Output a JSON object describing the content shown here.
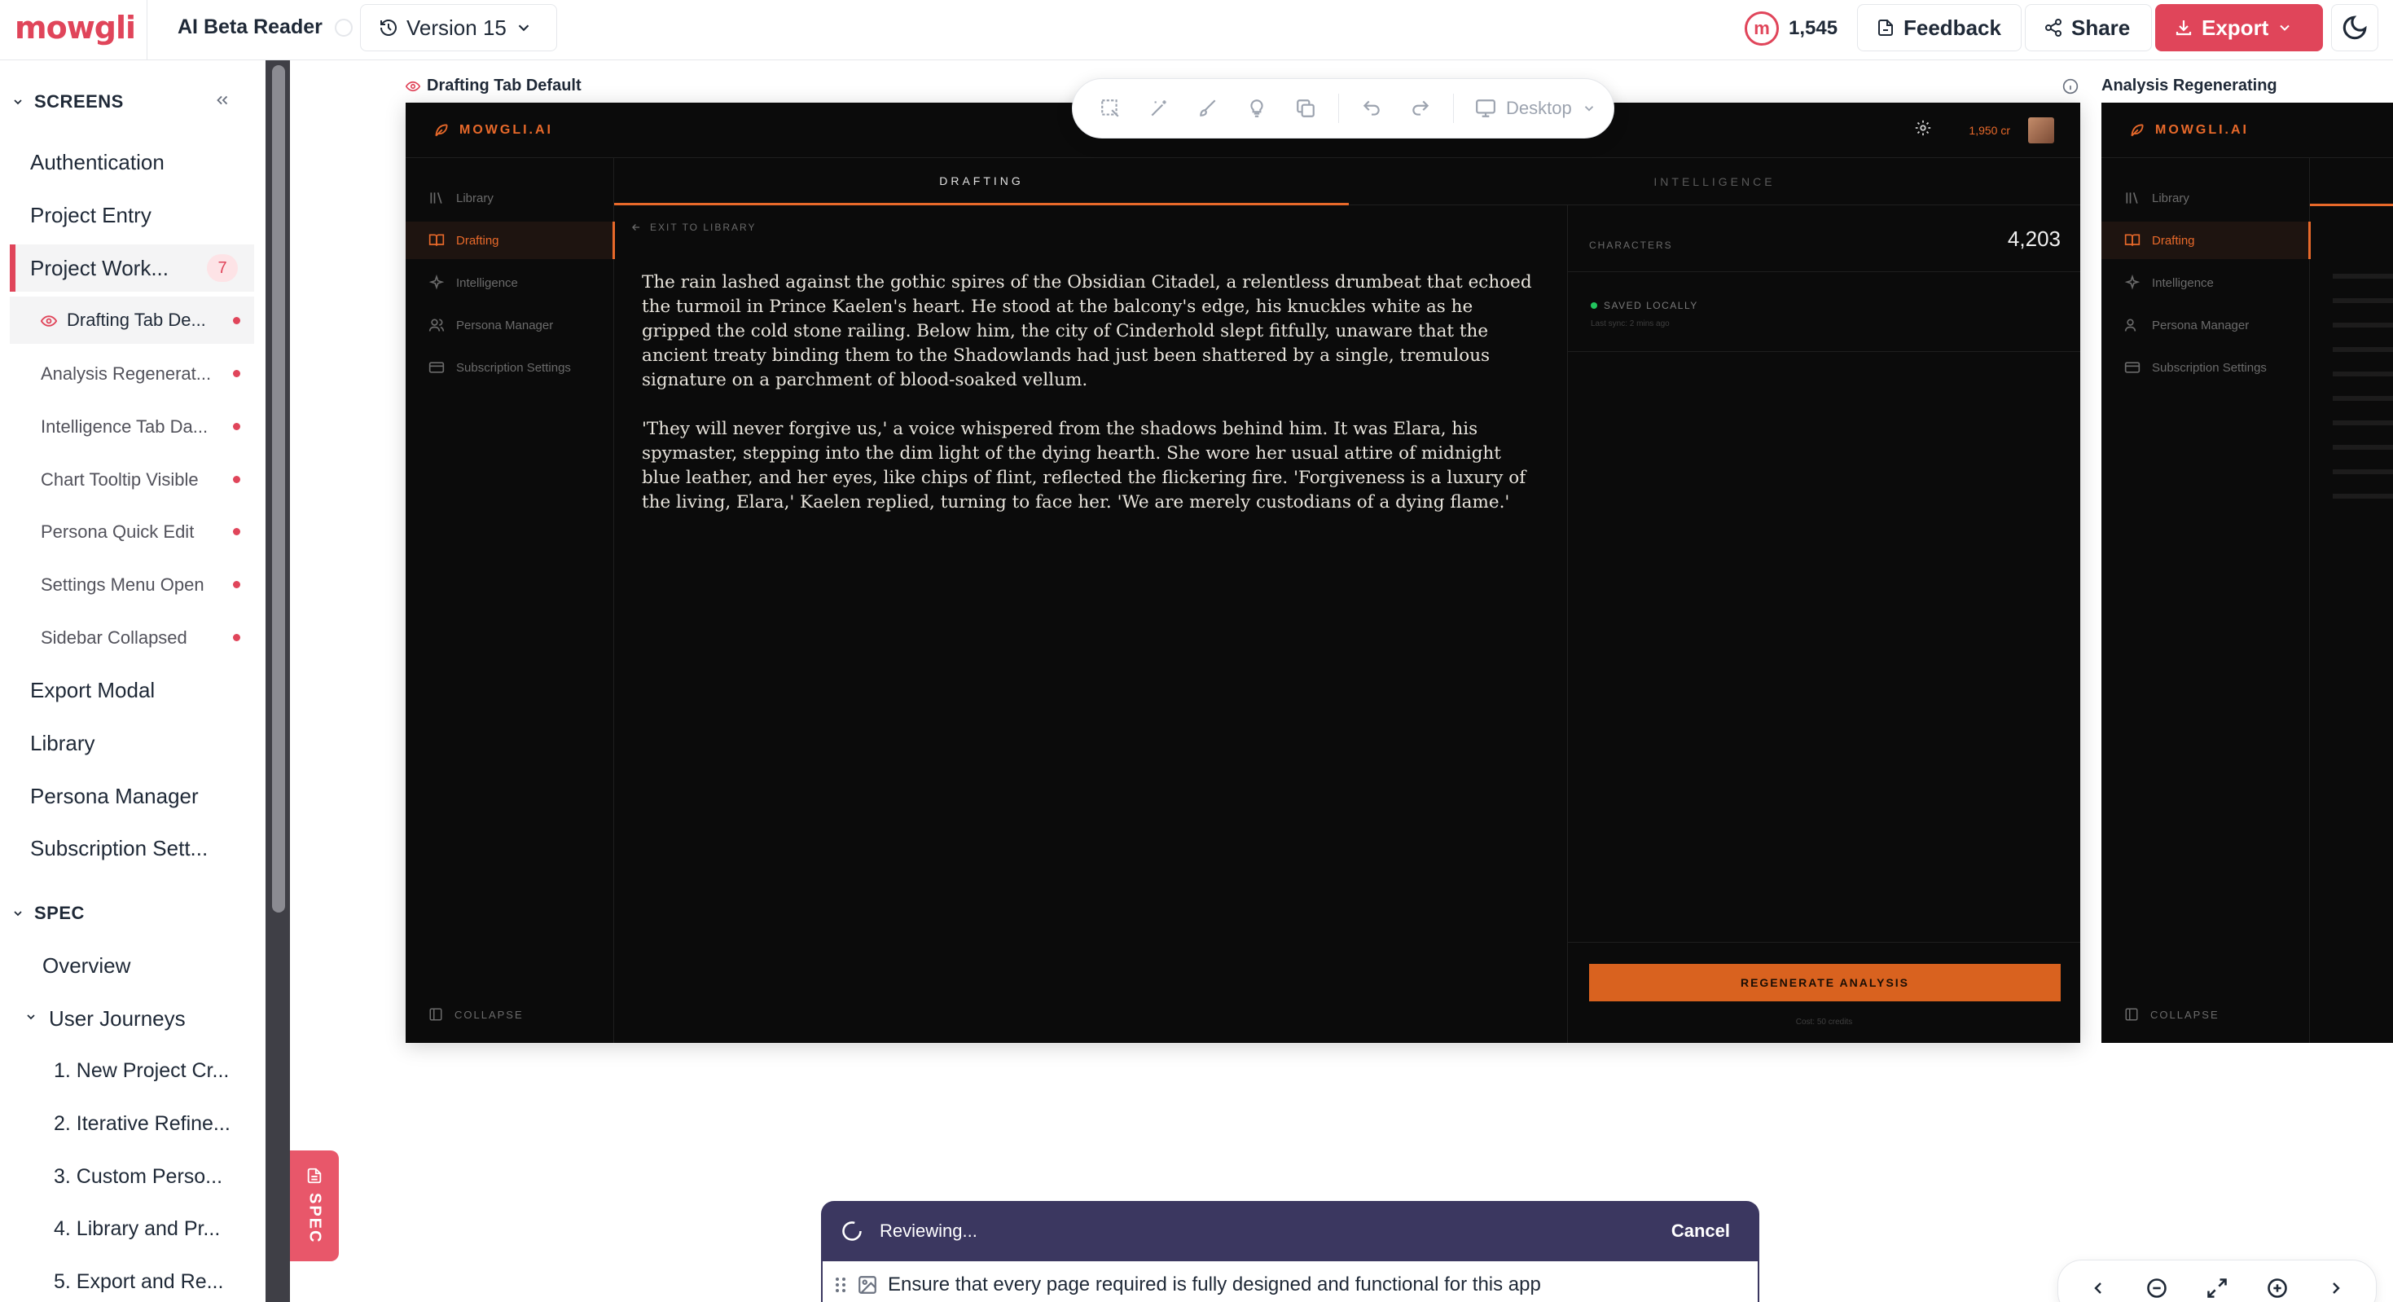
{
  "topbar": {
    "logo": "mowgli",
    "app_title": "AI Beta Reader",
    "version_label": "Version 15",
    "credits": "1,545",
    "credits_badge": "m",
    "feedback_label": "Feedback",
    "share_label": "Share",
    "export_label": "Export"
  },
  "sidebar": {
    "screens_heading": "SCREENS",
    "spec_heading": "SPEC",
    "screens": [
      {
        "label": "Authentication"
      },
      {
        "label": "Project Entry"
      },
      {
        "label": "Project Work...",
        "badge": "7"
      },
      {
        "label": "Export Modal"
      },
      {
        "label": "Library"
      },
      {
        "label": "Persona Manager"
      },
      {
        "label": "Subscription Sett..."
      }
    ],
    "project_children": [
      {
        "label": "Drafting Tab De..."
      },
      {
        "label": "Analysis Regenerat..."
      },
      {
        "label": "Intelligence Tab Da..."
      },
      {
        "label": "Chart Tooltip Visible"
      },
      {
        "label": "Persona Quick Edit"
      },
      {
        "label": "Settings Menu Open"
      },
      {
        "label": "Sidebar Collapsed"
      }
    ],
    "spec_items": [
      {
        "label": "Overview"
      },
      {
        "label": "User Journeys"
      }
    ],
    "journeys": [
      {
        "label": "1. New Project Cr..."
      },
      {
        "label": "2. Iterative Refine..."
      },
      {
        "label": "3. Custom Perso..."
      },
      {
        "label": "4. Library and Pr..."
      },
      {
        "label": "5. Export and Re..."
      }
    ]
  },
  "canvas": {
    "frame1_label": "Drafting Tab Default",
    "frame2_label": "Analysis Regenerating",
    "spec_tab_label": "SPEC"
  },
  "toolbar": {
    "device": "Desktop"
  },
  "mockup": {
    "brand": "MOWGLI.AI",
    "credits": "1,950 cr",
    "nav": [
      {
        "label": "Library",
        "icon": "library-icon"
      },
      {
        "label": "Drafting",
        "icon": "book-icon"
      },
      {
        "label": "Intelligence",
        "icon": "sparkle-icon"
      },
      {
        "label": "Persona Manager",
        "icon": "users-icon"
      },
      {
        "label": "Subscription Settings",
        "icon": "card-icon"
      }
    ],
    "collapse_label": "COLLAPSE",
    "tabs": [
      "DRAFTING",
      "INTELLIGENCE"
    ],
    "exit_label": "EXIT TO LIBRARY",
    "paragraphs": [
      "The rain lashed against the gothic spires of the Obsidian Citadel, a relentless drumbeat that echoed the turmoil in Prince Kaelen's heart. He stood at the balcony's edge, his knuckles white as he gripped the cold stone railing. Below him, the city of Cinderhold slept fitfully, unaware that the ancient treaty binding them to the Shadowlands had just been shattered by a single, tremulous signature on a parchment of blood-soaked vellum.",
      "'They will never forgive us,' a voice whispered from the shadows behind him. It was Elara, his spymaster, stepping into the dim light of the dying hearth. She wore her usual attire of midnight blue leather, and her eyes, like chips of flint, reflected the flickering fire. 'Forgiveness is a luxury of the living, Elara,' Kaelen replied, turning to face her. 'We are merely custodians of a dying flame.'"
    ],
    "characters_label": "CHARACTERS",
    "characters_value": "4,203",
    "saved_label": "SAVED LOCALLY",
    "last_sync": "Last sync: 2 mins ago",
    "regen_label": "REGENERATE ANALYSIS",
    "cost_label": "Cost: 50 credits"
  },
  "review": {
    "status": "Reviewing...",
    "cancel_label": "Cancel",
    "prompt": "Ensure that every page required is fully designed and functional for this app"
  },
  "colors": {
    "brand": "#e0455a",
    "mockup_accent": "#e8692a",
    "review_bar": "#3b3760"
  }
}
